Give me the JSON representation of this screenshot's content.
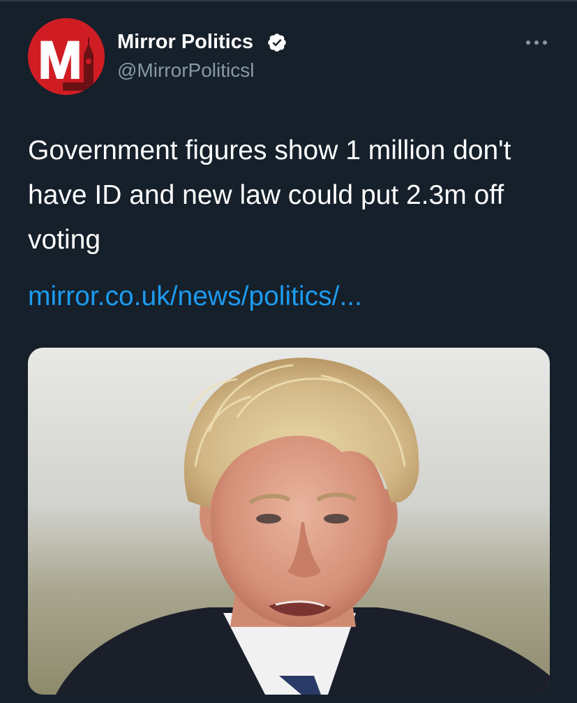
{
  "tweet": {
    "author": {
      "name": "Mirror Politics",
      "handle": "@MirrorPoliticsl",
      "avatar_letter": "M",
      "verified": true
    },
    "text": "Government figures show 1 million don't have ID and new law could put 2.3m off voting",
    "link": "mirror.co.uk/news/politics/...",
    "media": {
      "icon": "news-photo"
    }
  },
  "colors": {
    "background": "#15202b",
    "text": "#ffffff",
    "secondary": "#8899a6",
    "link": "#1d9bf0",
    "brand_red": "#d01d24",
    "verified_badge": "#ffffff"
  },
  "icons": {
    "verified": "verified-badge-icon",
    "more": "more-options-icon"
  }
}
